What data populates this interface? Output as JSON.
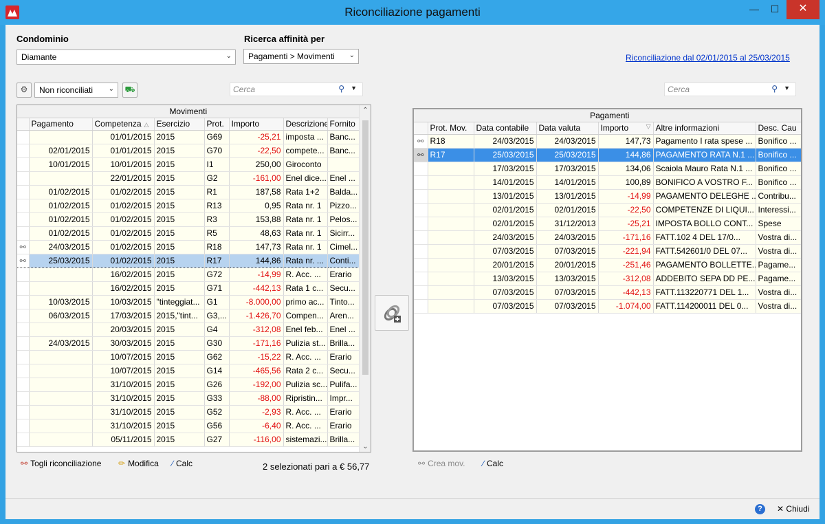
{
  "window": {
    "title": "Riconciliazione pagamenti"
  },
  "condominio": {
    "label": "Condominio",
    "value": "Diamante"
  },
  "ricerca": {
    "label": "Ricerca affinità per",
    "value": "Pagamenti > Movimenti"
  },
  "period_link": "Riconciliazione dal 02/01/2015 al 25/03/2015",
  "filter": {
    "value": "Non riconciliati"
  },
  "search_left": {
    "placeholder": "Cerca"
  },
  "search_right": {
    "placeholder": "Cerca"
  },
  "movimenti": {
    "caption": "Movimenti",
    "columns": [
      "Pagamento",
      "Competenza",
      "Esercizio",
      "Prot.",
      "Importo",
      "Descrizione",
      "Fornito"
    ],
    "rows": [
      {
        "ind": "",
        "pagamento": "",
        "competenza": "01/01/2015",
        "esercizio": "2015",
        "prot": "G69",
        "importo": "-25,21",
        "neg": true,
        "descr": "imposta ...",
        "fornito": "Banc..."
      },
      {
        "ind": "",
        "pagamento": "02/01/2015",
        "competenza": "01/01/2015",
        "esercizio": "2015",
        "prot": "G70",
        "importo": "-22,50",
        "neg": true,
        "descr": "compete...",
        "fornito": "Banc..."
      },
      {
        "ind": "",
        "pagamento": "10/01/2015",
        "competenza": "10/01/2015",
        "esercizio": "2015",
        "prot": "I1",
        "importo": "250,00",
        "neg": false,
        "descr": "Giroconto",
        "fornito": ""
      },
      {
        "ind": "",
        "pagamento": "",
        "competenza": "22/01/2015",
        "esercizio": "2015",
        "prot": "G2",
        "importo": "-161,00",
        "neg": true,
        "descr": "Enel dice...",
        "fornito": "Enel ..."
      },
      {
        "ind": "",
        "pagamento": "01/02/2015",
        "competenza": "01/02/2015",
        "esercizio": "2015",
        "prot": "R1",
        "importo": "187,58",
        "neg": false,
        "descr": "Rata 1+2",
        "fornito": "Balda..."
      },
      {
        "ind": "",
        "pagamento": "01/02/2015",
        "competenza": "01/02/2015",
        "esercizio": "2015",
        "prot": "R13",
        "importo": "0,95",
        "neg": false,
        "descr": "Rata nr. 1",
        "fornito": "Pizzo..."
      },
      {
        "ind": "",
        "pagamento": "01/02/2015",
        "competenza": "01/02/2015",
        "esercizio": "2015",
        "prot": "R3",
        "importo": "153,88",
        "neg": false,
        "descr": "Rata nr. 1",
        "fornito": "Pelos..."
      },
      {
        "ind": "",
        "pagamento": "01/02/2015",
        "competenza": "01/02/2015",
        "esercizio": "2015",
        "prot": "R5",
        "importo": "48,63",
        "neg": false,
        "descr": "Rata nr. 1",
        "fornito": "Sicirr..."
      },
      {
        "ind": "link",
        "pagamento": "24/03/2015",
        "competenza": "01/02/2015",
        "esercizio": "2015",
        "prot": "R18",
        "importo": "147,73",
        "neg": false,
        "descr": "Rata nr. 1",
        "fornito": "Cimel..."
      },
      {
        "ind": "link",
        "pagamento": "25/03/2015",
        "competenza": "01/02/2015",
        "esercizio": "2015",
        "prot": "R17",
        "importo": "144,86",
        "neg": false,
        "descr": "Rata nr. ...",
        "fornito": "Conti...",
        "selected": true
      },
      {
        "ind": "",
        "pagamento": "",
        "competenza": "16/02/2015",
        "esercizio": "2015",
        "prot": "G72",
        "importo": "-14,99",
        "neg": true,
        "descr": "R. Acc. ...",
        "fornito": "Erario"
      },
      {
        "ind": "",
        "pagamento": "",
        "competenza": "16/02/2015",
        "esercizio": "2015",
        "prot": "G71",
        "importo": "-442,13",
        "neg": true,
        "descr": "Rata 1 c...",
        "fornito": "Secu..."
      },
      {
        "ind": "",
        "pagamento": "10/03/2015",
        "competenza": "10/03/2015",
        "esercizio": "\"tinteggiat...",
        "prot": "G1",
        "importo": "-8.000,00",
        "neg": true,
        "descr": "primo ac...",
        "fornito": "Tinto..."
      },
      {
        "ind": "",
        "pagamento": "06/03/2015",
        "competenza": "17/03/2015",
        "esercizio": "2015,\"tint...",
        "prot": "G3,...",
        "importo": "-1.426,70",
        "neg": true,
        "descr": "Compen...",
        "fornito": "Aren..."
      },
      {
        "ind": "",
        "pagamento": "",
        "competenza": "20/03/2015",
        "esercizio": "2015",
        "prot": "G4",
        "importo": "-312,08",
        "neg": true,
        "descr": "Enel feb...",
        "fornito": "Enel ..."
      },
      {
        "ind": "",
        "pagamento": "24/03/2015",
        "competenza": "30/03/2015",
        "esercizio": "2015",
        "prot": "G30",
        "importo": "-171,16",
        "neg": true,
        "descr": "Pulizia st...",
        "fornito": "Brilla..."
      },
      {
        "ind": "",
        "pagamento": "",
        "competenza": "10/07/2015",
        "esercizio": "2015",
        "prot": "G62",
        "importo": "-15,22",
        "neg": true,
        "descr": "R. Acc. ...",
        "fornito": "Erario"
      },
      {
        "ind": "",
        "pagamento": "",
        "competenza": "10/07/2015",
        "esercizio": "2015",
        "prot": "G14",
        "importo": "-465,56",
        "neg": true,
        "descr": "Rata 2 c...",
        "fornito": "Secu..."
      },
      {
        "ind": "",
        "pagamento": "",
        "competenza": "31/10/2015",
        "esercizio": "2015",
        "prot": "G26",
        "importo": "-192,00",
        "neg": true,
        "descr": "Pulizia sc...",
        "fornito": "Pulifa..."
      },
      {
        "ind": "",
        "pagamento": "",
        "competenza": "31/10/2015",
        "esercizio": "2015",
        "prot": "G33",
        "importo": "-88,00",
        "neg": true,
        "descr": "Ripristin...",
        "fornito": "Impr..."
      },
      {
        "ind": "",
        "pagamento": "",
        "competenza": "31/10/2015",
        "esercizio": "2015",
        "prot": "G52",
        "importo": "-2,93",
        "neg": true,
        "descr": "R. Acc. ...",
        "fornito": "Erario"
      },
      {
        "ind": "",
        "pagamento": "",
        "competenza": "31/10/2015",
        "esercizio": "2015",
        "prot": "G56",
        "importo": "-6,40",
        "neg": true,
        "descr": "R. Acc. ...",
        "fornito": "Erario"
      },
      {
        "ind": "",
        "pagamento": "",
        "competenza": "05/11/2015",
        "esercizio": "2015",
        "prot": "G27",
        "importo": "-116,00",
        "neg": true,
        "descr": "sistemazi...",
        "fornito": "Brilla..."
      }
    ]
  },
  "pagamenti": {
    "caption": "Pagamenti",
    "columns": [
      "Prot. Mov.",
      "Data contabile",
      "Data valuta",
      "Importo",
      "Altre informazioni",
      "Desc. Cau"
    ],
    "rows": [
      {
        "ind": "link",
        "prot": "R18",
        "contabile": "24/03/2015",
        "valuta": "24/03/2015",
        "importo": "147,73",
        "neg": false,
        "info": "Pagamento I rata spese ...",
        "causale": "Bonifico ..."
      },
      {
        "ind": "link",
        "prot": "R17",
        "contabile": "25/03/2015",
        "valuta": "25/03/2015",
        "importo": "144,86",
        "neg": false,
        "info": "PAGAMENTO RATA N.1 ...",
        "causale": "Bonifico ...",
        "selected": true
      },
      {
        "ind": "",
        "prot": "",
        "contabile": "17/03/2015",
        "valuta": "17/03/2015",
        "importo": "134,06",
        "neg": false,
        "info": "Scaiola Mauro Rata N.1 ...",
        "causale": "Bonifico ..."
      },
      {
        "ind": "",
        "prot": "",
        "contabile": "14/01/2015",
        "valuta": "14/01/2015",
        "importo": "100,89",
        "neg": false,
        "info": "BONIFICO A VOSTRO F...",
        "causale": "Bonifico ..."
      },
      {
        "ind": "",
        "prot": "",
        "contabile": "13/01/2015",
        "valuta": "13/01/2015",
        "importo": "-14,99",
        "neg": true,
        "info": "PAGAMENTO DELEGHE ...",
        "causale": "Contribu..."
      },
      {
        "ind": "",
        "prot": "",
        "contabile": "02/01/2015",
        "valuta": "02/01/2015",
        "importo": "-22,50",
        "neg": true,
        "info": "COMPETENZE DI LIQUI...",
        "causale": "Interessi..."
      },
      {
        "ind": "",
        "prot": "",
        "contabile": "02/01/2015",
        "valuta": "31/12/2013",
        "importo": "-25,21",
        "neg": true,
        "info": "IMPOSTA BOLLO CONT...",
        "causale": "Spese"
      },
      {
        "ind": "",
        "prot": "",
        "contabile": "24/03/2015",
        "valuta": "24/03/2015",
        "importo": "-171,16",
        "neg": true,
        "info": "FATT.102   4 DEL 17/0...",
        "causale": "Vostra di..."
      },
      {
        "ind": "",
        "prot": "",
        "contabile": "07/03/2015",
        "valuta": "07/03/2015",
        "importo": "-221,94",
        "neg": true,
        "info": "FATT.542601/0 DEL 07...",
        "causale": "Vostra di..."
      },
      {
        "ind": "",
        "prot": "",
        "contabile": "20/01/2015",
        "valuta": "20/01/2015",
        "importo": "-251,46",
        "neg": true,
        "info": "PAGAMENTO BOLLETTE...",
        "causale": "Pagame..."
      },
      {
        "ind": "",
        "prot": "",
        "contabile": "13/03/2015",
        "valuta": "13/03/2015",
        "importo": "-312,08",
        "neg": true,
        "info": "ADDEBITO SEPA DD PE...",
        "causale": "Pagame..."
      },
      {
        "ind": "",
        "prot": "",
        "contabile": "07/03/2015",
        "valuta": "07/03/2015",
        "importo": "-442,13",
        "neg": true,
        "info": "FATT.113220771 DEL 1...",
        "causale": "Vostra di..."
      },
      {
        "ind": "",
        "prot": "",
        "contabile": "07/03/2015",
        "valuta": "07/03/2015",
        "importo": "-1.074,00",
        "neg": true,
        "info": "FATT.114200011 DEL 0...",
        "causale": "Vostra di..."
      }
    ]
  },
  "actions_left": {
    "togli": "Togli riconciliazione",
    "modifica": "Modifica",
    "calc": "Calc"
  },
  "selection_summary": "2 selezionati pari a € 56,77",
  "actions_right": {
    "crea": "Crea mov.",
    "calc": "Calc"
  },
  "footer": {
    "chiudi": "Chiudi"
  }
}
